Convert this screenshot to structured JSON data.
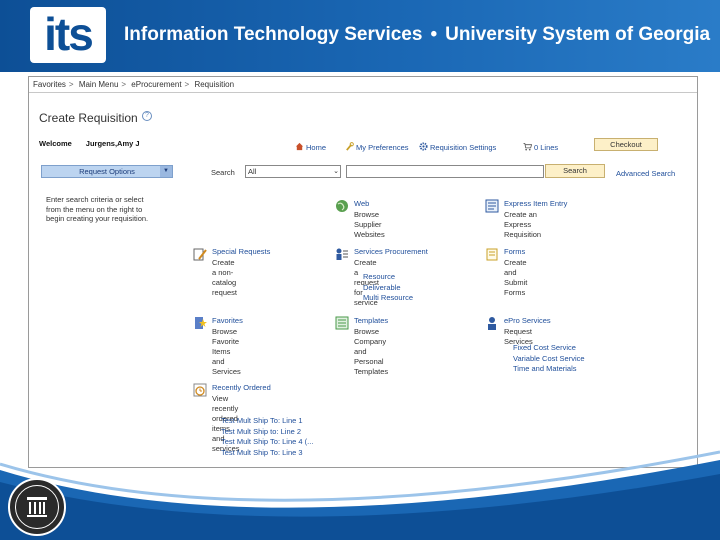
{
  "banner": {
    "logo": "its",
    "title_left": "Information Technology Services",
    "separator": "•",
    "title_right": "University System of Georgia"
  },
  "seal_text": "BOARD OF REGENTS OF THE UNIVERSITY SYSTEM OF GEORGIA",
  "breadcrumb": [
    "Favorites",
    "Main Menu",
    "eProcurement",
    "Requisition"
  ],
  "breadcrumb_sep": ">",
  "page": {
    "title": "Create Requisition",
    "help": "?",
    "welcome_label": "Welcome",
    "user": "Jurgens,Amy J"
  },
  "topnav": {
    "home": "Home",
    "preferences": "My Preferences",
    "settings": "Requisition Settings",
    "items": "0 Lines",
    "checkout": "Checkout"
  },
  "searchbar": {
    "request_options": "Request Options",
    "label": "Search",
    "category": "All",
    "query": "",
    "button": "Search",
    "advanced": "Advanced Search"
  },
  "hint": "Enter search criteria or select from the menu on the right to begin creating your requisition.",
  "tiles": {
    "web": {
      "title": "Web",
      "desc": "Browse Supplier Websites"
    },
    "express": {
      "title": "Express Item Entry",
      "desc": "Create an Express Requisition"
    },
    "special": {
      "title": "Special Requests",
      "desc": "Create a non-catalog request"
    },
    "services": {
      "title": "Services Procurement",
      "desc": "Create a request for service",
      "links": [
        "Resource",
        "Deliverable",
        "Multi Resource"
      ]
    },
    "forms": {
      "title": "Forms",
      "desc": "Create and Submit Forms"
    },
    "favorites": {
      "title": "Favorites",
      "desc1": "Browse Favorite Items and",
      "desc2": "Services"
    },
    "templates": {
      "title": "Templates",
      "desc1": "Browse Company and Personal",
      "desc2": "Templates"
    },
    "epro": {
      "title": "ePro Services",
      "desc": "Request Services",
      "links": [
        "Fixed Cost Service",
        "Variable Cost Service",
        "Time and Materials"
      ]
    },
    "recent": {
      "title": "Recently Ordered",
      "desc1": "View recently ordered items and",
      "desc2": "services",
      "links": [
        "Test Mult Ship To: Line 1",
        "Test Mult Ship to: Line 2",
        "Test Mult Ship To: Line 4 (...",
        "Test Mult Ship To: Line 3"
      ]
    }
  },
  "colors": {
    "banner": "#1a67b4",
    "link": "#1f4e9a",
    "button": "#fdf0c8"
  }
}
